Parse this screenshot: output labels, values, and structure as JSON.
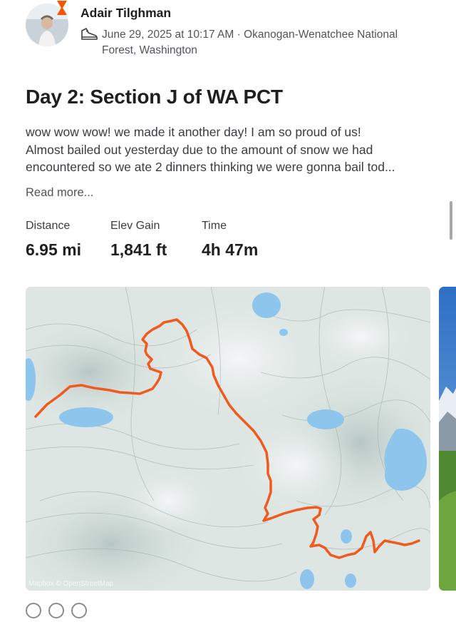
{
  "athlete": {
    "name": "Adair Tilghman",
    "activity_icon": "hiking-shoe-icon"
  },
  "meta": {
    "datetime": "June 29, 2025 at 10:17 AM",
    "separator": " · ",
    "location": "Okanogan-Wenatchee National Forest, Washington"
  },
  "activity": {
    "title": "Day 2: Section J of WA PCT",
    "description_lines": [
      "wow wow wow! we made it another day! I am so proud of us!",
      "Almost bailed out yesterday due to the amount of snow we had",
      "encountered so we ate 2 dinners thinking we were gonna bail tod..."
    ],
    "read_more": "Read more..."
  },
  "stats": [
    {
      "label": "Distance",
      "value": "6.95 mi"
    },
    {
      "label": "Elev Gain",
      "value": "1,841 ft"
    },
    {
      "label": "Time",
      "value": "4h 47m"
    }
  ],
  "map": {
    "attribution": "Mapbox © OpenStreetMap",
    "route_color": "#f05a1e",
    "water_color": "#8ec5ec"
  },
  "colors": {
    "brand_orange": "#fc5200",
    "text_primary": "#1f1f1f",
    "text_secondary": "#52545a"
  }
}
